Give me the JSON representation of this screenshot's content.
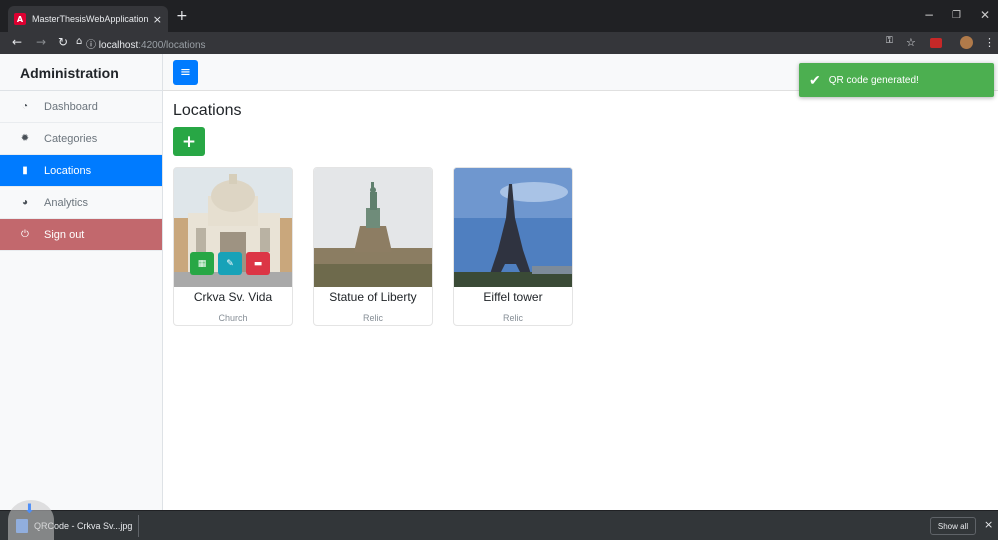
{
  "browser": {
    "tab_title": "MasterThesisWebApplicationFro",
    "tab_close": "×",
    "new_tab": "+",
    "url_host": "localhost",
    "url_path": ":4200/locations",
    "win_minimize": "−",
    "win_restore": "❐",
    "win_close": "✕"
  },
  "sidebar": {
    "title": "Administration",
    "items": [
      {
        "label": "Dashboard",
        "icon": "dashboard-icon"
      },
      {
        "label": "Categories",
        "icon": "categories-icon"
      },
      {
        "label": "Locations",
        "icon": "map-icon"
      },
      {
        "label": "Analytics",
        "icon": "pie-chart-icon"
      },
      {
        "label": "Sign out",
        "icon": "power-icon"
      }
    ]
  },
  "main": {
    "title": "Locations",
    "add_label": "+",
    "cards": [
      {
        "name": "Crkva Sv. Vida",
        "type": "Church"
      },
      {
        "name": "Statue of Liberty",
        "type": "Relic"
      },
      {
        "name": "Eiffel tower",
        "type": "Relic"
      }
    ]
  },
  "toast": {
    "message": "QR code generated!",
    "color": "#4caf50"
  },
  "downloads": {
    "file_name": "QRCode - Crkva Sv...jpg",
    "show_all": "Show all",
    "close": "×"
  },
  "colors": {
    "primary": "#007bff",
    "success": "#28a745",
    "info": "#17a2b8",
    "danger": "#dc3545",
    "signout": "#c2686d"
  }
}
